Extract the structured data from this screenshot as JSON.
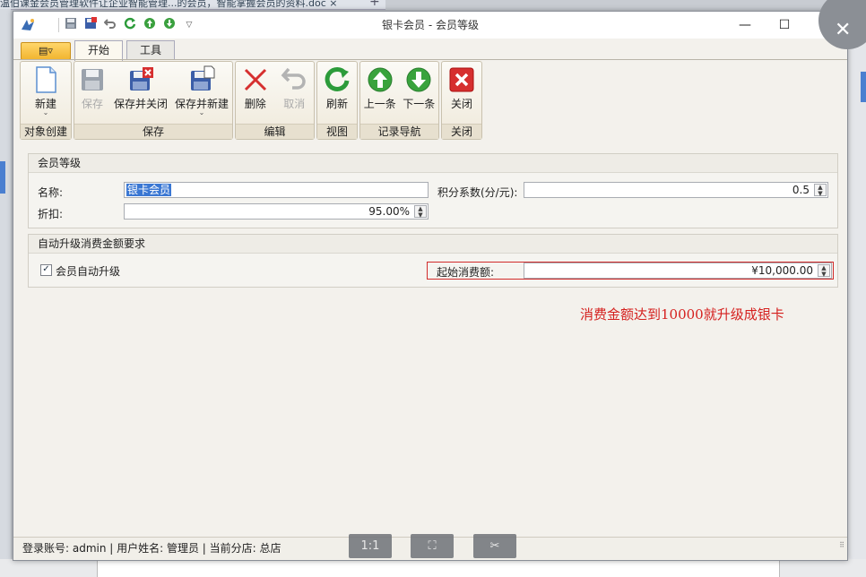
{
  "background": {
    "doc_tab": "温伯课金会员管理软件让企业智能管理...的会员，智能掌握会员的资料.doc",
    "doc_tab_close": "×",
    "new_tab": "+"
  },
  "window": {
    "title": "银卡会员 - 会员等级",
    "minimize": "—",
    "maximize": "☐",
    "close": "✕"
  },
  "ribbon": {
    "app_menu": "▤▿",
    "tabs": [
      {
        "label": "开始",
        "active": true
      },
      {
        "label": "工具",
        "active": false
      }
    ],
    "groups": [
      {
        "label": "对象创建",
        "buttons": [
          {
            "label": "新建"
          }
        ]
      },
      {
        "label": "保存",
        "buttons": [
          {
            "label": "保存"
          },
          {
            "label": "保存并关闭"
          },
          {
            "label": "保存并新建"
          }
        ]
      },
      {
        "label": "编辑",
        "buttons": [
          {
            "label": "删除"
          },
          {
            "label": "取消"
          }
        ]
      },
      {
        "label": "视图",
        "buttons": [
          {
            "label": "刷新"
          }
        ]
      },
      {
        "label": "记录导航",
        "buttons": [
          {
            "label": "上一条"
          },
          {
            "label": "下一条"
          }
        ]
      },
      {
        "label": "关闭",
        "buttons": [
          {
            "label": "关闭"
          }
        ]
      }
    ]
  },
  "member_level": {
    "section_title": "会员等级",
    "name_label": "名称:",
    "name_value": "银卡会员",
    "points_label": "积分系数(分/元):",
    "points_value": "0.5",
    "discount_label": "折扣:",
    "discount_value": "95.00%"
  },
  "auto_upgrade": {
    "section_title": "自动升级消费金额要求",
    "checkbox_label": "会员自动升级",
    "checked": true,
    "start_amount_label": "起始消费额:",
    "start_amount_value": "¥10,000.00",
    "hint": "消费金额达到10000就升级成银卡"
  },
  "statusbar": {
    "text": "登录账号: admin  |  用户姓名: 管理员  |  当前分店: 总店"
  },
  "viewer": {
    "actual_size": "1:1",
    "fit": "⛶",
    "crop": "✂"
  },
  "colors": {
    "accent_blue": "#3a77d3",
    "hint_red": "#d5201e",
    "highlight_border": "#d22b2b"
  }
}
